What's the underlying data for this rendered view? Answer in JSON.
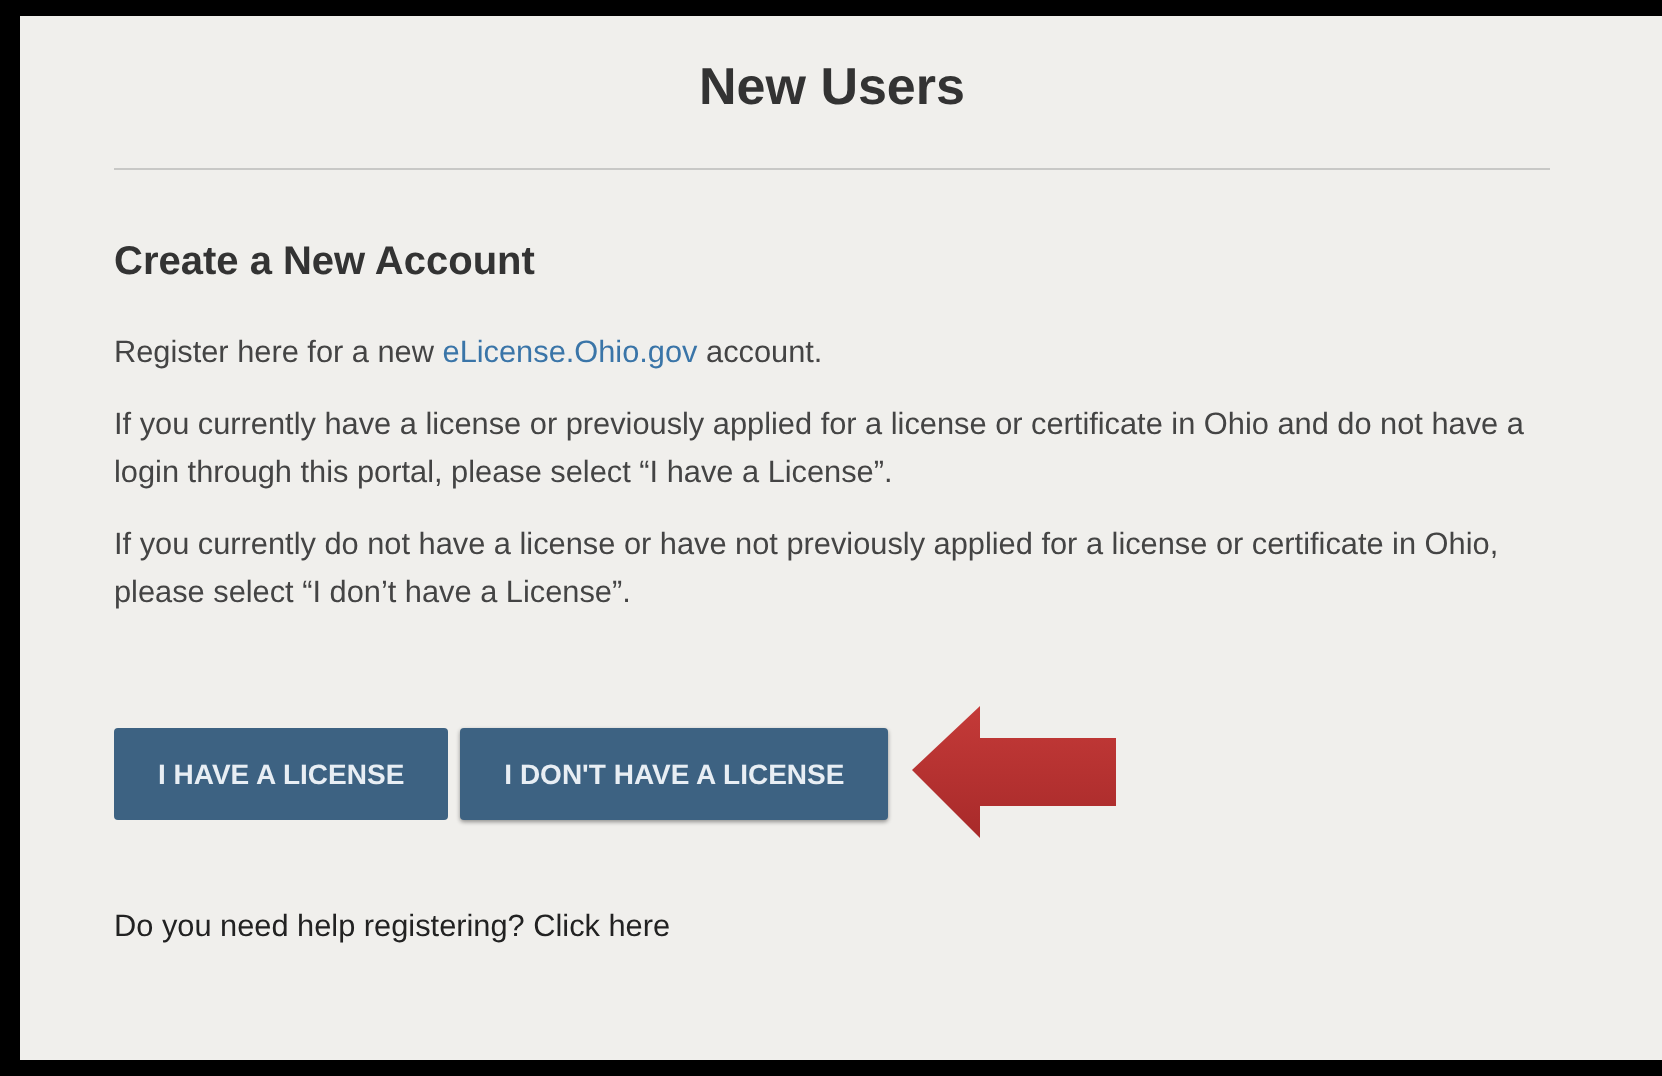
{
  "title": "New Users",
  "heading": "Create a New Account",
  "intro": {
    "before": "Register here for a new",
    "link": "eLicense.Ohio.gov",
    "after": "account."
  },
  "paragraphs": [
    "If you currently have a license or previously applied for a license or certificate in Ohio and do not have a login through this portal, please select “I have a License”.",
    "If you currently do not have a license or have not previously applied for a license or certificate in Ohio, please select “I don’t have a License”."
  ],
  "buttons": [
    {
      "label": "I HAVE A LICENSE",
      "highlighted": false
    },
    {
      "label": "I DON'T HAVE A LICENSE",
      "highlighted": true
    }
  ],
  "help": "Do you need help registering? Click here"
}
